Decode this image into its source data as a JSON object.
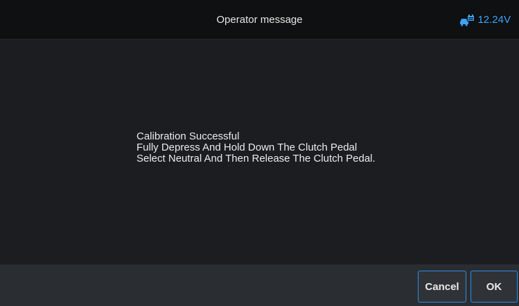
{
  "header": {
    "title": "Operator message",
    "voltage": "12.24V",
    "voltage_icon": "vehicle-battery-icon",
    "accent_color": "#3aa3ff"
  },
  "message": {
    "lines": [
      "Calibration Successful",
      "Fully Depress And Hold Down The Clutch Pedal",
      "Select Neutral And Then Release The Clutch Pedal."
    ]
  },
  "footer": {
    "cancel_label": "Cancel",
    "ok_label": "OK"
  }
}
